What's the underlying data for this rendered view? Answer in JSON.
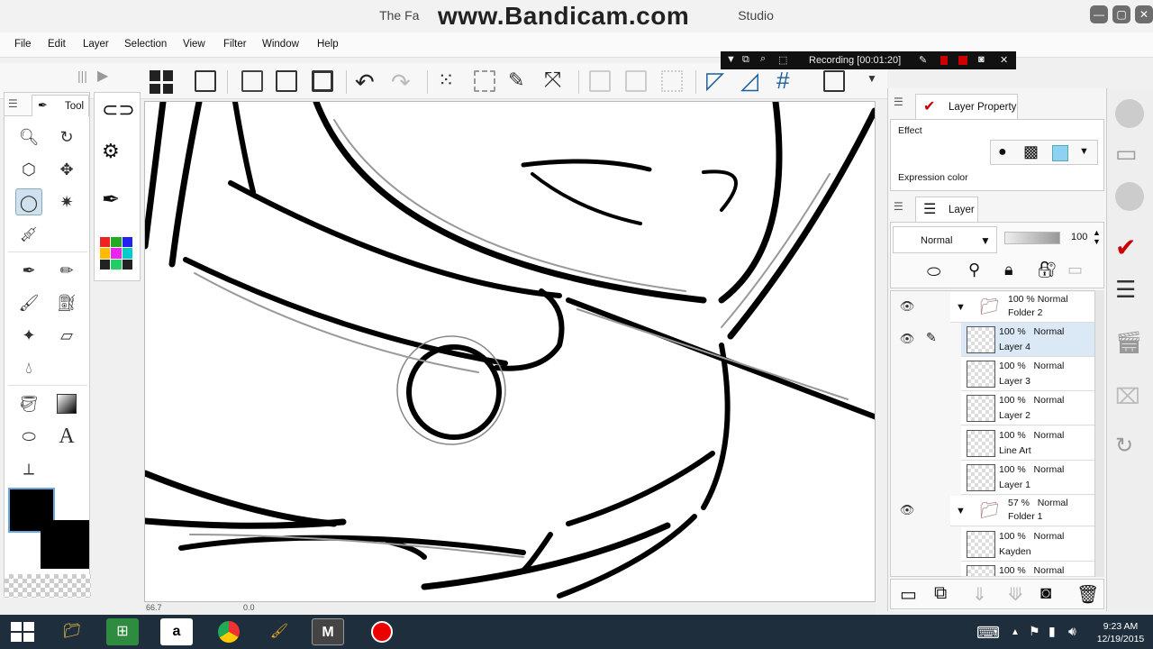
{
  "window": {
    "title_prefix": "The Fa",
    "title_suffix": "Studio",
    "watermark": "www.Bandicam.com"
  },
  "menu": [
    "File",
    "Edit",
    "Layer",
    "Selection",
    "View",
    "Filter",
    "Window",
    "Help"
  ],
  "recording": {
    "label": "Recording [00:01:20]"
  },
  "tool_panel": {
    "tab_label": "Tool"
  },
  "layer_property": {
    "tab_label": "Layer Property",
    "effect_label": "Effect",
    "expression_color_label": "Expression color"
  },
  "layer_panel": {
    "tab_label": "Layer",
    "blend_mode": "Normal",
    "opacity": "100",
    "layers": [
      {
        "kind": "folder",
        "opacity": "100 %",
        "mode": "Normal",
        "name": "Folder 2",
        "visible": true
      },
      {
        "kind": "layer",
        "opacity": "100 %",
        "mode": "Normal",
        "name": "Layer 4",
        "visible": true,
        "selected": true
      },
      {
        "kind": "layer",
        "opacity": "100 %",
        "mode": "Normal",
        "name": "Layer 3"
      },
      {
        "kind": "layer",
        "opacity": "100 %",
        "mode": "Normal",
        "name": "Layer 2"
      },
      {
        "kind": "layer",
        "opacity": "100 %",
        "mode": "Normal",
        "name": "Line Art"
      },
      {
        "kind": "layer",
        "opacity": "100 %",
        "mode": "Normal",
        "name": "Layer 1"
      },
      {
        "kind": "folder",
        "opacity": "57 %",
        "mode": "Normal",
        "name": "Folder 1",
        "visible": true
      },
      {
        "kind": "layer",
        "opacity": "100 %",
        "mode": "Normal",
        "name": "Kayden"
      },
      {
        "kind": "layer",
        "opacity": "100 %",
        "mode": "Normal",
        "name": ""
      }
    ]
  },
  "status": {
    "zoom": "66.7",
    "angle": "0.0"
  },
  "taskbar": {
    "time": "9:23 AM",
    "date": "12/19/2015"
  },
  "colors": {
    "accent": "#cc0000",
    "selection": "#dbe8f5",
    "taskbar": "#1f2e3c"
  }
}
